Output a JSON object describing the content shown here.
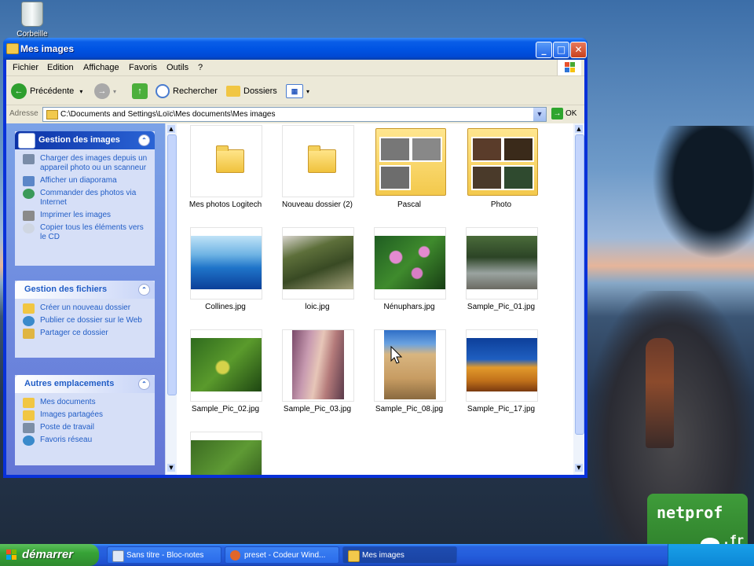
{
  "desktop": {
    "recycle_bin_label": "Corbeille"
  },
  "window": {
    "title": "Mes images",
    "menu": [
      "Fichier",
      "Edition",
      "Affichage",
      "Favoris",
      "Outils",
      "?"
    ],
    "toolbar": {
      "back_label": "Précédente",
      "search_label": "Rechercher",
      "folders_label": "Dossiers"
    },
    "address": {
      "label": "Adresse",
      "value": "C:\\Documents and Settings\\Loïc\\Mes documents\\Mes images",
      "go_label": "OK"
    }
  },
  "sidebar": {
    "panels": [
      {
        "title": "Gestion des images",
        "links": [
          "Charger des images depuis un appareil photo ou un scanneur",
          "Afficher un diaporama",
          "Commander des photos via Internet",
          "Imprimer les images",
          "Copier tous les éléments vers le CD"
        ]
      },
      {
        "title": "Gestion des fichiers",
        "links": [
          "Créer un nouveau dossier",
          "Publier ce dossier sur le Web",
          "Partager ce dossier"
        ]
      },
      {
        "title": "Autres emplacements",
        "links": [
          "Mes documents",
          "Images partagées",
          "Poste de travail",
          "Favoris réseau"
        ]
      }
    ]
  },
  "files": [
    "Mes photos Logitech",
    "Nouveau dossier (2)",
    "Pascal",
    "Photo",
    "Collines.jpg",
    "loic.jpg",
    "Nénuphars.jpg",
    "Sample_Pic_01.jpg",
    "Sample_Pic_02.jpg",
    "Sample_Pic_03.jpg",
    "Sample_Pic_08.jpg",
    "Sample_Pic_17.jpg"
  ],
  "taskbar": {
    "start_label": "démarrer",
    "tasks": [
      "Sans titre - Bloc-notes",
      "preset - Codeur Wind...",
      "Mes images"
    ]
  },
  "watermark": {
    "brand": "netprof",
    "tld": ".fr"
  },
  "colors": {
    "title_blue": "#0054e3",
    "sidebar_blue": "#7ba2e7",
    "link_blue": "#215dc6",
    "start_green": "#37a337"
  }
}
